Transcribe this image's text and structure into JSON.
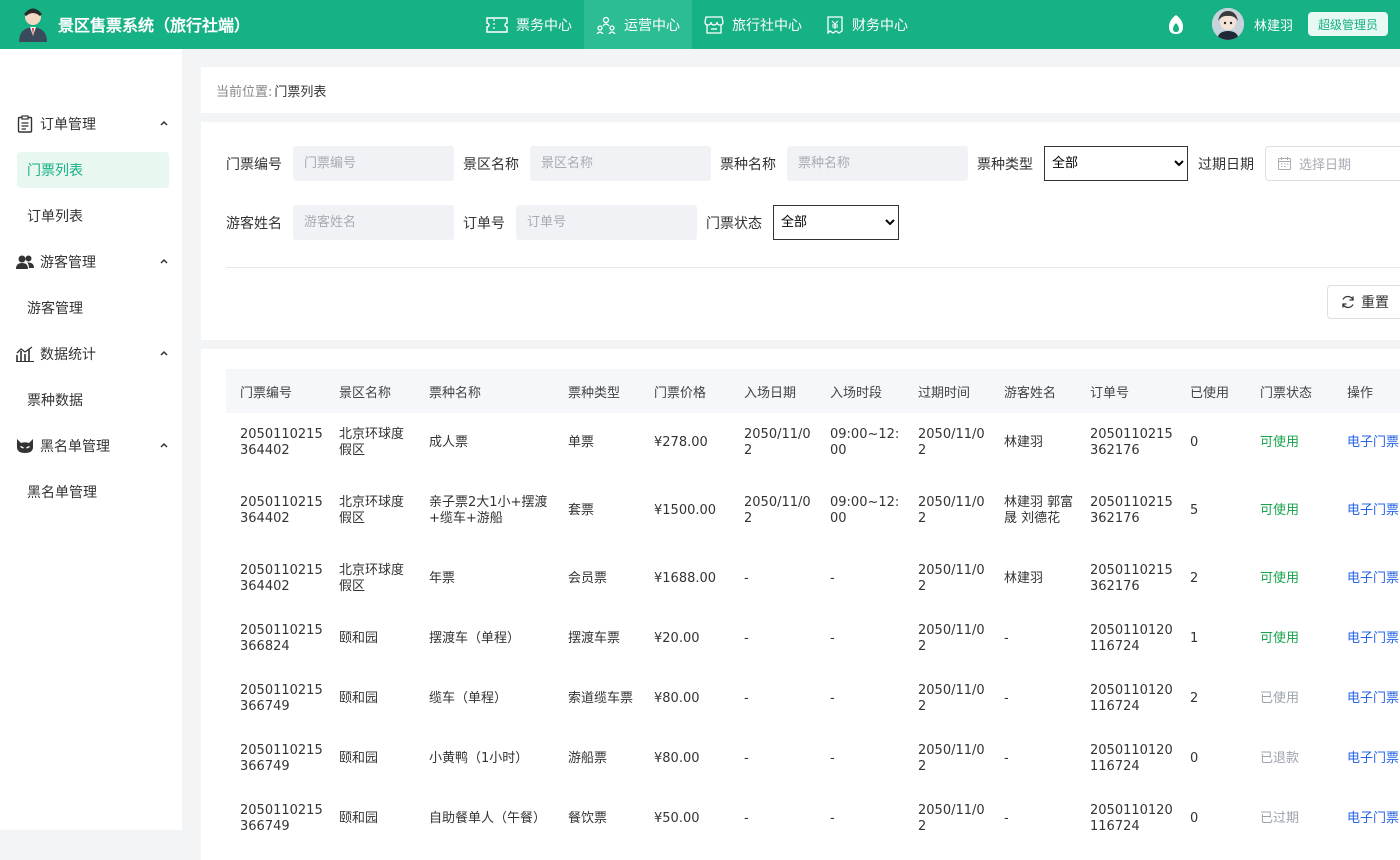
{
  "app": {
    "title": "景区售票系统（旅行社端）",
    "nav": [
      "票务中心",
      "运营中心",
      "旅行社中心",
      "财务中心"
    ],
    "active_nav": "运营中心",
    "user_name": "林建羽",
    "role": "超级管理员",
    "accent_color": "#16b185"
  },
  "sidebar": {
    "groups": [
      {
        "label": "订单管理",
        "icon": "clipboard-icon",
        "items": [
          "门票列表",
          "订单列表"
        ]
      },
      {
        "label": "游客管理",
        "icon": "users-icon",
        "items": [
          "游客管理"
        ]
      },
      {
        "label": "数据统计",
        "icon": "chart-icon",
        "items": [
          "票种数据"
        ]
      },
      {
        "label": "黑名单管理",
        "icon": "cat-face-icon",
        "items": [
          "黑名单管理"
        ]
      }
    ],
    "active_item": "门票列表"
  },
  "breadcrumb": {
    "label": "当前位置:",
    "current": "门票列表"
  },
  "filters": {
    "ticket_no": {
      "label": "门票编号",
      "placeholder": "门票编号"
    },
    "scenic_name": {
      "label": "景区名称",
      "placeholder": "景区名称"
    },
    "ticket_kind_name": {
      "label": "票种名称",
      "placeholder": "票种名称"
    },
    "ticket_type": {
      "label": "票种类型",
      "value": "全部"
    },
    "expire_date": {
      "label": "过期日期",
      "placeholder": "选择日期"
    },
    "visitor_name": {
      "label": "游客姓名",
      "placeholder": "游客姓名"
    },
    "order_no": {
      "label": "订单号",
      "placeholder": "订单号"
    },
    "ticket_status": {
      "label": "门票状态",
      "value": "全部"
    },
    "reset_label": "重置"
  },
  "table": {
    "columns": [
      "门票编号",
      "景区名称",
      "票种名称",
      "票种类型",
      "门票价格",
      "入场日期",
      "入场时段",
      "过期时间",
      "游客姓名",
      "订单号",
      "已使用",
      "门票状态",
      "操作"
    ],
    "rows": [
      {
        "ticket_no": "2050110215364402",
        "scenic": "北京环球度假区",
        "kind": "成人票",
        "type": "单票",
        "price": "¥278.00",
        "entry_date": "2050/11/02",
        "slot": "09:00~12:00",
        "expire": "2050/11/02",
        "visitor": "林建羽",
        "order_no": "2050110215362176",
        "used": "0",
        "status": "可使用",
        "action": "电子门票"
      },
      {
        "ticket_no": "2050110215364402",
        "scenic": "北京环球度假区",
        "kind": "亲子票2大1小+摆渡+缆车+游船",
        "type": "套票",
        "price": "¥1500.00",
        "entry_date": "2050/11/02",
        "slot": "09:00~12:00",
        "expire": "2050/11/02",
        "visitor": "林建羽 郭富晟 刘德花",
        "order_no": "2050110215362176",
        "used": "5",
        "status": "可使用",
        "action": "电子门票"
      },
      {
        "ticket_no": "2050110215364402",
        "scenic": "北京环球度假区",
        "kind": "年票",
        "type": "会员票",
        "price": "¥1688.00",
        "entry_date": "-",
        "slot": "-",
        "expire": "2050/11/02",
        "visitor": "林建羽",
        "order_no": "2050110215362176",
        "used": "2",
        "status": "可使用",
        "action": "电子门票"
      },
      {
        "ticket_no": "2050110215366824",
        "scenic": "颐和园",
        "kind": "摆渡车（单程）",
        "type": "摆渡车票",
        "price": "¥20.00",
        "entry_date": "-",
        "slot": "-",
        "expire": "2050/11/02",
        "visitor": "-",
        "order_no": "2050110120116724",
        "used": "1",
        "status": "可使用",
        "action": "电子门票"
      },
      {
        "ticket_no": "2050110215366749",
        "scenic": "颐和园",
        "kind": "缆车（单程）",
        "type": "索道缆车票",
        "price": "¥80.00",
        "entry_date": "-",
        "slot": "-",
        "expire": "2050/11/02",
        "visitor": "-",
        "order_no": "2050110120116724",
        "used": "2",
        "status": "已使用",
        "action": "电子门票"
      },
      {
        "ticket_no": "2050110215366749",
        "scenic": "颐和园",
        "kind": "小黄鸭（1小时）",
        "type": "游船票",
        "price": "¥80.00",
        "entry_date": "-",
        "slot": "-",
        "expire": "2050/11/02",
        "visitor": "-",
        "order_no": "2050110120116724",
        "used": "0",
        "status": "已退款",
        "action": "电子门票"
      },
      {
        "ticket_no": "2050110215366749",
        "scenic": "颐和园",
        "kind": "自助餐单人（午餐）",
        "type": "餐饮票",
        "price": "¥50.00",
        "entry_date": "-",
        "slot": "-",
        "expire": "2050/11/02",
        "visitor": "-",
        "order_no": "2050110120116724",
        "used": "0",
        "status": "已过期",
        "action": "电子门票"
      }
    ]
  }
}
